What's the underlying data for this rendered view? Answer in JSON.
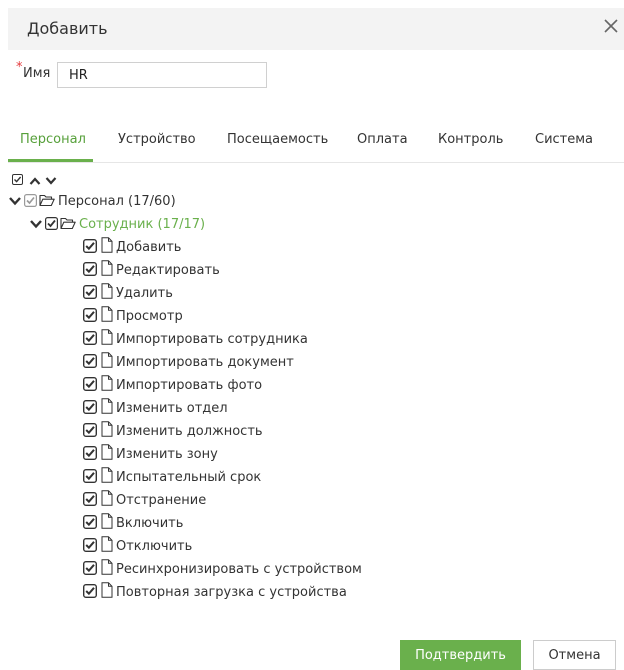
{
  "dialog": {
    "title": "Добавить",
    "close_icon": "close-icon"
  },
  "form": {
    "required_mark": "*",
    "name_label": "Имя",
    "name_value": "HR"
  },
  "tabs": [
    {
      "label": "Персонал",
      "active": true
    },
    {
      "label": "Устройство",
      "active": false
    },
    {
      "label": "Посещаемость",
      "active": false
    },
    {
      "label": "Оплата",
      "active": false
    },
    {
      "label": "Контроль",
      "active": false
    },
    {
      "label": "Система",
      "active": false
    }
  ],
  "toolbar": {
    "select_all_icon": "checkbox-icon",
    "collapse_icon": "chevron-up-icon",
    "expand_icon": "chevron-down-icon"
  },
  "tree": {
    "root": {
      "label": "Персонал (17/60)",
      "state": "partial",
      "expanded": true
    },
    "group": {
      "label": "Сотрудник (17/17)",
      "state": "checked",
      "expanded": true
    },
    "items": [
      "Добавить",
      "Редактировать",
      "Удалить",
      "Просмотр",
      "Импортировать сотрудника",
      "Импортировать документ",
      "Импортировать фото",
      "Изменить отдел",
      "Изменить должность",
      "Изменить зону",
      "Испытательный срок",
      "Отстранение",
      "Включить",
      "Отключить",
      "Ресинхронизировать с устройством",
      "Повторная загрузка с устройства"
    ]
  },
  "footer": {
    "confirm_label": "Подтвердить",
    "cancel_label": "Отмена"
  },
  "colors": {
    "accent": "#6ab04c",
    "required": "#e4393c",
    "header_bg": "#f3f3f3"
  }
}
